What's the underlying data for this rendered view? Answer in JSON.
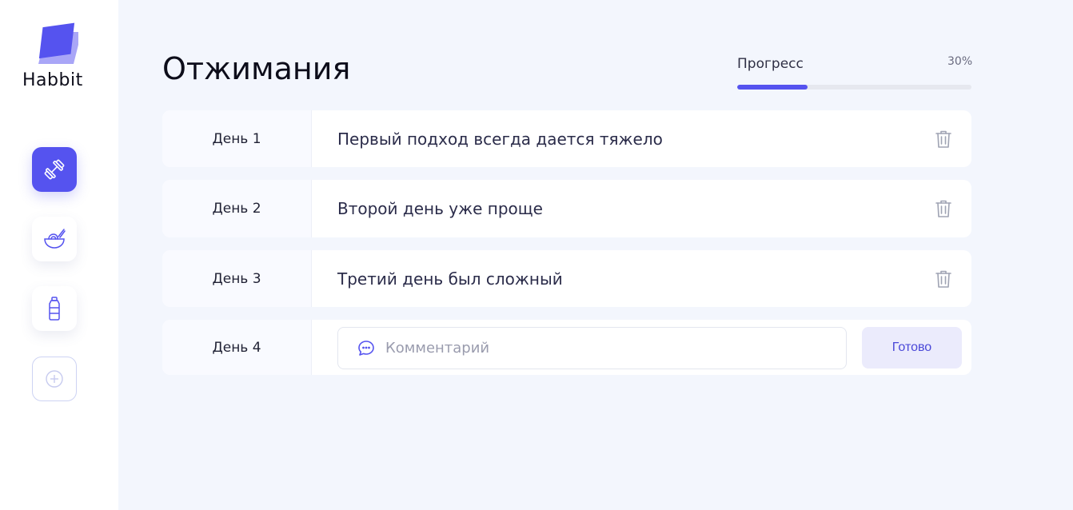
{
  "app": {
    "name": "Habbit"
  },
  "sidebar": {
    "items": [
      {
        "icon": "dumbbell-icon",
        "active": true
      },
      {
        "icon": "food-bowl-icon",
        "active": false
      },
      {
        "icon": "water-bottle-icon",
        "active": false
      },
      {
        "icon": "add-circle-icon",
        "active": false
      }
    ]
  },
  "habit": {
    "title": "Отжимания"
  },
  "progress": {
    "label": "Прогресс",
    "value_text": "30%",
    "value": 30
  },
  "entries": [
    {
      "day": "День 1",
      "comment": "Первый подход всегда дается тяжело"
    },
    {
      "day": "День 2",
      "comment": "Второй день уже проще"
    },
    {
      "day": "День 3",
      "comment": "Третий день был сложный"
    }
  ],
  "new_entry": {
    "day": "День 4",
    "comment_placeholder": "Комментарий",
    "comment_value": "",
    "done_label": "Готово"
  },
  "colors": {
    "accent": "#5553ef",
    "background": "#f3f6fd"
  }
}
